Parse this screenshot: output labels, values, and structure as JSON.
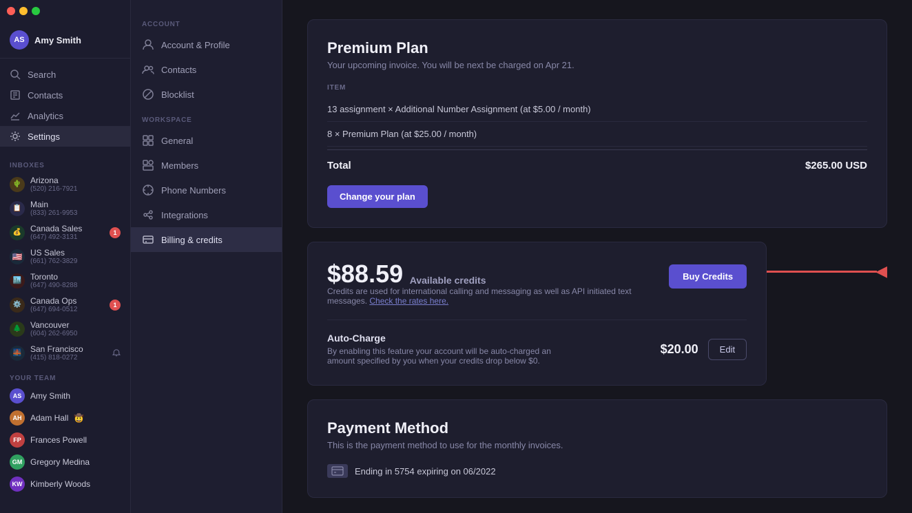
{
  "window": {
    "title": "Billing & Credits"
  },
  "sidebar": {
    "user": {
      "name": "Amy Smith",
      "initials": "AS"
    },
    "nav_items": [
      {
        "id": "search",
        "label": "Search",
        "icon": "search"
      },
      {
        "id": "contacts",
        "label": "Contacts",
        "icon": "contacts"
      },
      {
        "id": "analytics",
        "label": "Analytics",
        "icon": "analytics"
      },
      {
        "id": "settings",
        "label": "Settings",
        "icon": "settings"
      }
    ],
    "inboxes_label": "Inboxes",
    "inboxes": [
      {
        "name": "Arizona",
        "number": "(520) 216-7921",
        "color": "#e8a030",
        "icon": "🌵",
        "badge": null
      },
      {
        "name": "Main",
        "number": "(833) 261-9953",
        "color": "#4a4a7a",
        "icon": "📋",
        "badge": null
      },
      {
        "name": "Canada Sales",
        "number": "(647) 492-3131",
        "color": "#40a870",
        "icon": "💰",
        "badge": 1
      },
      {
        "name": "US Sales",
        "number": "(661) 762-3829",
        "color": "#5a8ae0",
        "icon": "🇺🇸",
        "badge": null
      },
      {
        "name": "Toronto",
        "number": "(647) 490-8288",
        "color": "#c05050",
        "icon": "🏙️",
        "badge": null
      },
      {
        "name": "Canada Ops",
        "number": "(647) 694-0512",
        "color": "#c06030",
        "icon": "⚙️",
        "badge": 1
      },
      {
        "name": "Vancouver",
        "number": "(604) 262-6950",
        "color": "#d0a030",
        "icon": "🌲",
        "badge": null
      },
      {
        "name": "San Francisco",
        "number": "(415) 818-0272",
        "color": "#4a7ac0",
        "icon": "🌉",
        "badge": null,
        "bell": true
      }
    ],
    "team_label": "Your team",
    "team": [
      {
        "name": "Amy Smith",
        "initials": "AS",
        "color": "#5a4fcf",
        "emoji": ""
      },
      {
        "name": "Adam Hall",
        "initials": "AH",
        "color": "#c07030",
        "emoji": "🤠"
      },
      {
        "name": "Frances Powell",
        "initials": "FP",
        "color": "#c04040",
        "emoji": ""
      },
      {
        "name": "Gregory Medina",
        "initials": "GM",
        "color": "#30a060",
        "emoji": ""
      },
      {
        "name": "Kimberly Woods",
        "initials": "KW",
        "color": "#7030c0",
        "emoji": ""
      }
    ]
  },
  "middle_nav": {
    "account_label": "Account",
    "account_items": [
      {
        "id": "account-profile",
        "label": "Account & Profile",
        "icon": "user"
      },
      {
        "id": "contacts",
        "label": "Contacts",
        "icon": "contacts2"
      },
      {
        "id": "blocklist",
        "label": "Blocklist",
        "icon": "block"
      }
    ],
    "workspace_label": "Workspace",
    "workspace_items": [
      {
        "id": "general",
        "label": "General",
        "icon": "grid"
      },
      {
        "id": "members",
        "label": "Members",
        "icon": "members"
      },
      {
        "id": "phone-numbers",
        "label": "Phone Numbers",
        "icon": "phone"
      },
      {
        "id": "integrations",
        "label": "Integrations",
        "icon": "integrations"
      },
      {
        "id": "billing",
        "label": "Billing & credits",
        "icon": "billing",
        "active": true
      }
    ]
  },
  "billing": {
    "plan_title": "Premium Plan",
    "plan_subtitle": "Your upcoming invoice. You will be next be charged on Apr 21.",
    "item_label": "ITEM",
    "line_items": [
      "13 assignment × Additional Number Assignment (at $5.00 / month)",
      "8 × Premium Plan (at $25.00 / month)"
    ],
    "total_label": "Total",
    "total_amount": "$265.00 USD",
    "change_plan_btn": "Change your plan",
    "credits_amount": "$88.59",
    "credits_label": "Available credits",
    "credits_desc": "Credits are used for international calling and messaging as well as API initiated text messages.",
    "credits_link": "Check the rates here.",
    "buy_credits_btn": "Buy Credits",
    "auto_charge_title": "Auto-Charge",
    "auto_charge_desc": "By enabling this feature your account will be auto-charged an amount specified by you when your credits drop below $0.",
    "auto_charge_amount": "$20.00",
    "auto_charge_edit": "Edit",
    "payment_title": "Payment Method",
    "payment_desc": "This is the payment method to use for the monthly invoices.",
    "payment_card": "Ending in 5754 expiring on 06/2022"
  }
}
